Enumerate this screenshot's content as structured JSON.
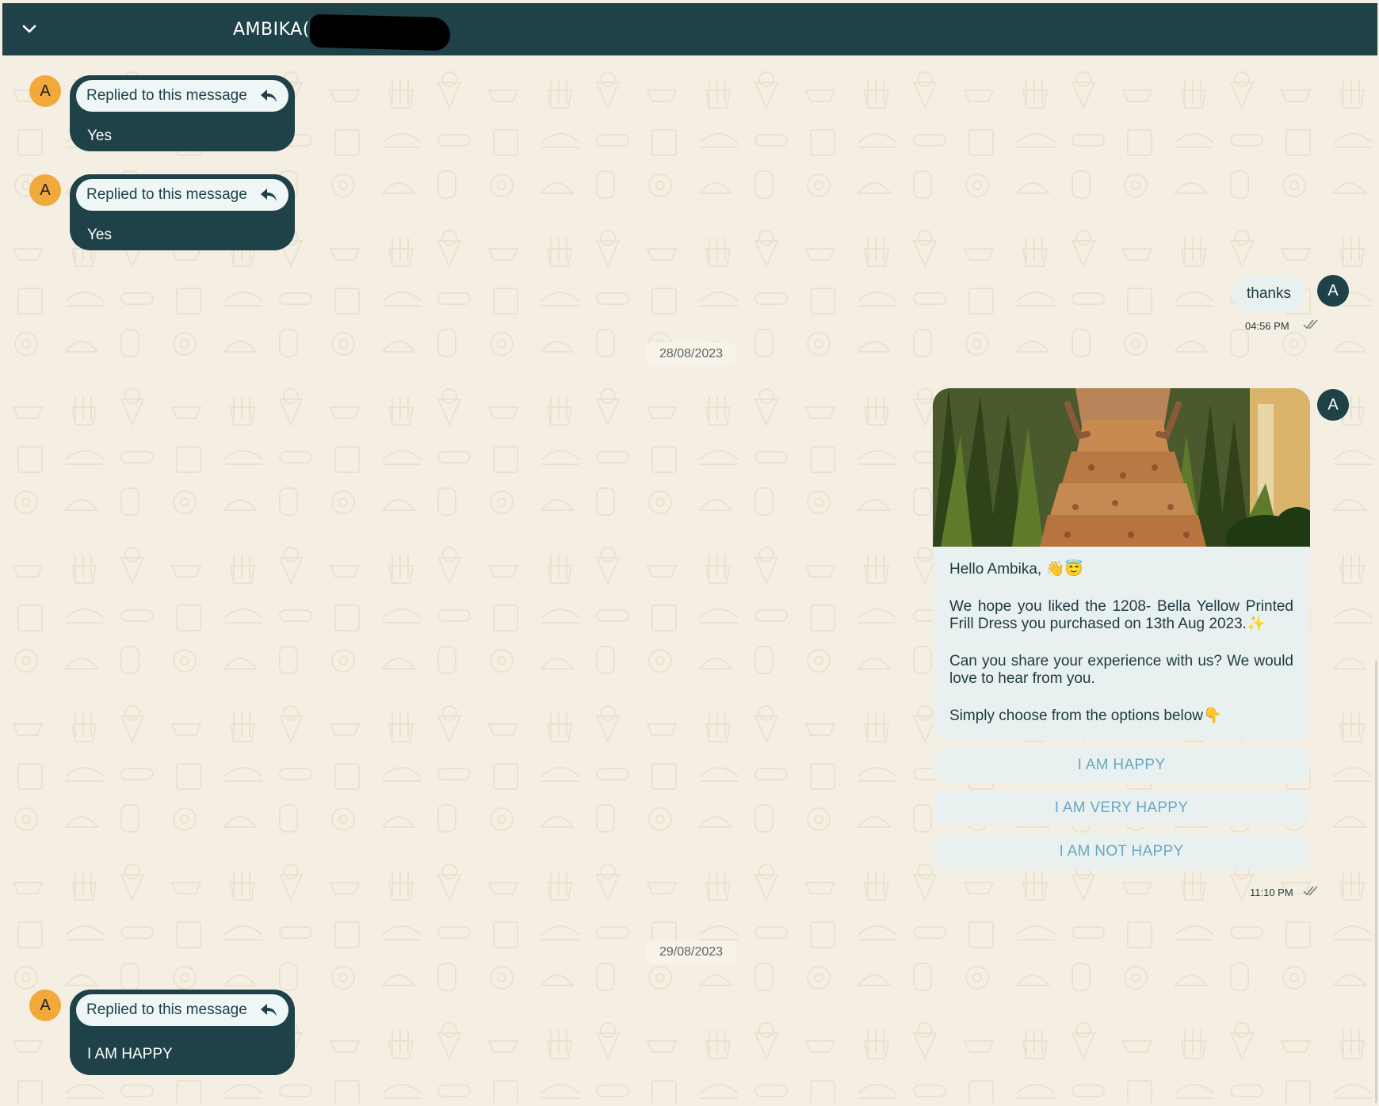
{
  "header": {
    "contact_name": "AMBIKA(+",
    "collapse_icon": "chevron-down-icon"
  },
  "colors": {
    "header_bg": "#1f4148",
    "chat_bg": "#f4efe2",
    "incoming_avatar": "#f2a93b",
    "outgoing_bubble": "#e8f1ef",
    "quick_reply_text": "#6aa6c6"
  },
  "messages": {
    "reply1": {
      "avatar": "A",
      "context_label": "Replied to this message",
      "text": "Yes"
    },
    "reply2": {
      "avatar": "A",
      "context_label": "Replied to this message",
      "text": "Yes"
    },
    "thanks": {
      "avatar": "A",
      "text": "thanks",
      "time": "04:56 PM"
    },
    "date1": "28/08/2023",
    "template": {
      "avatar": "A",
      "greeting": "Hello Ambika, 👋😇",
      "paragraph1": "We hope you liked the 1208- Bella Yellow Printed Frill Dress you purchased on 13th Aug 2023.✨",
      "paragraph2": "Can you share your experience with us? We would love to hear from you.",
      "paragraph3": "Simply choose from the options below👇",
      "buttons": [
        "I AM HAPPY",
        "I AM VERY HAPPY",
        "I AM NOT HAPPY"
      ],
      "time": "11:10 PM"
    },
    "date2": "29/08/2023",
    "reply3": {
      "avatar": "A",
      "context_label": "Replied to this message",
      "text": "I AM HAPPY"
    }
  }
}
